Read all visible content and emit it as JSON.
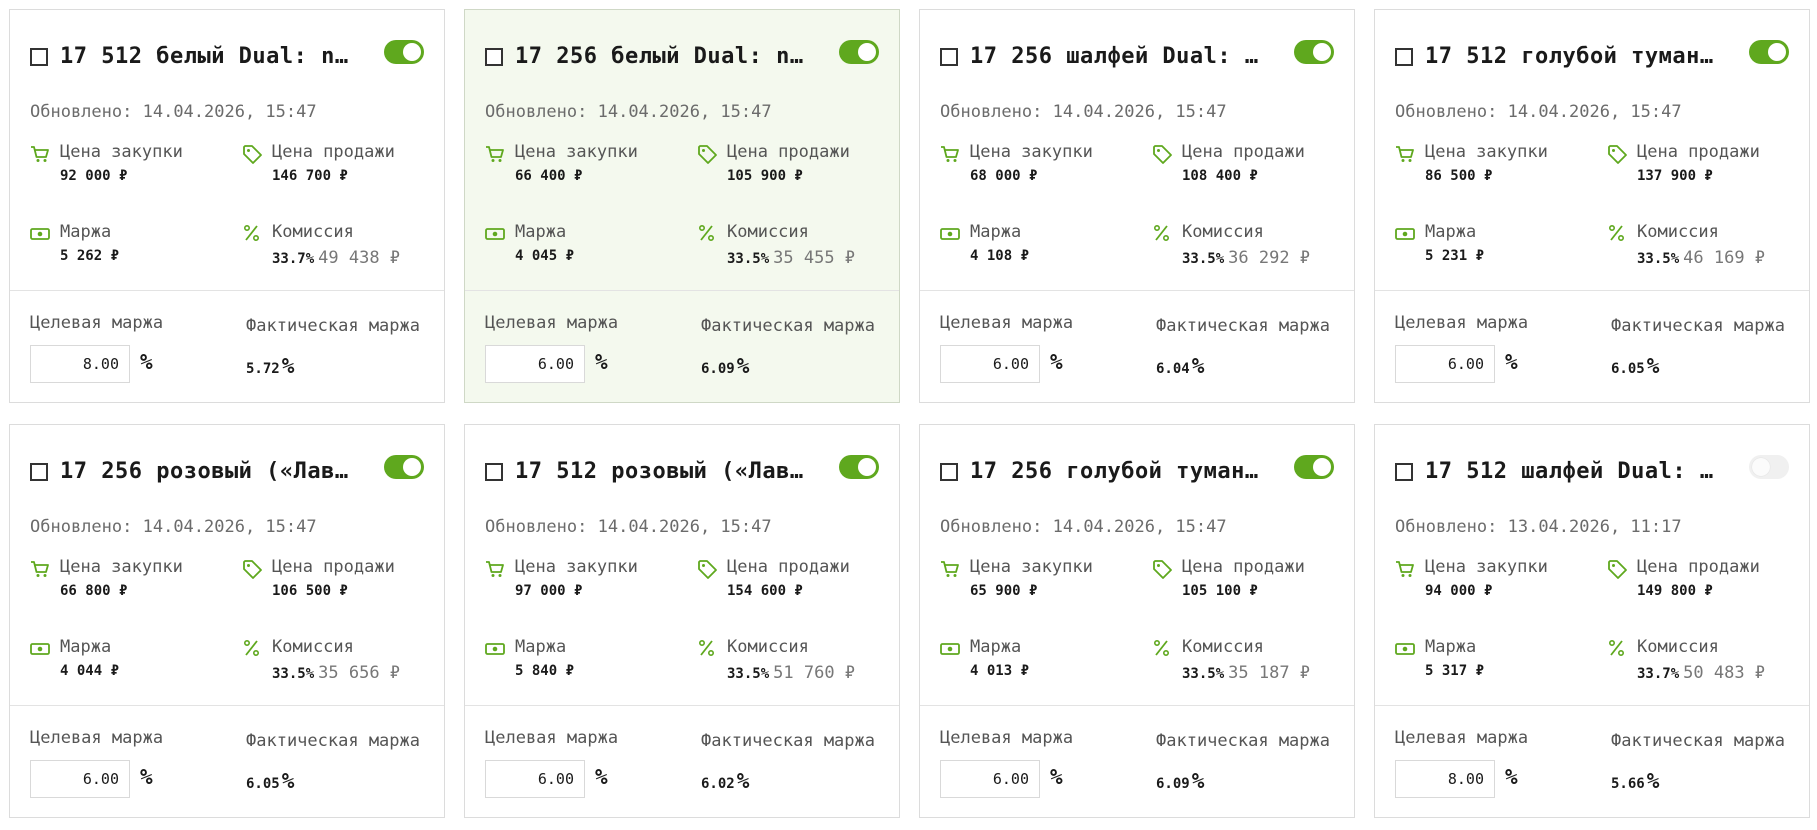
{
  "labels": {
    "updated_prefix": "Обновлено:",
    "buy_price": "Цена закупки",
    "sell_price": "Цена продажи",
    "margin": "Маржа",
    "commission": "Комиссия",
    "target_margin": "Целевая маржа",
    "actual_margin": "Фактическая маржа",
    "percent": "%"
  },
  "colors": {
    "accent": "#5fa81e",
    "selected_bg": "#f4f9ee"
  },
  "cards": [
    {
      "title": "17 512 белый Dual: na…",
      "enabled": true,
      "selected": false,
      "updated": "14.04.2026, 15:47",
      "buy": "92 000 ₽",
      "sell": "146 700 ₽",
      "margin": "5 262 ₽",
      "commission_pct": "33.7%",
      "commission_rub": "49 438 ₽",
      "target": "8.00",
      "actual": "5.72"
    },
    {
      "title": "17 256 белый Dual: na…",
      "enabled": true,
      "selected": true,
      "updated": "14.04.2026, 15:47",
      "buy": "66 400 ₽",
      "sell": "105 900 ₽",
      "margin": "4 045 ₽",
      "commission_pct": "33.5%",
      "commission_rub": "35 455 ₽",
      "target": "6.00",
      "actual": "6.09"
    },
    {
      "title": "17 256 шалфей Dual: n…",
      "enabled": true,
      "selected": false,
      "updated": "14.04.2026, 15:47",
      "buy": "68 000 ₽",
      "sell": "108 400 ₽",
      "margin": "4 108 ₽",
      "commission_pct": "33.5%",
      "commission_rub": "36 292 ₽",
      "target": "6.00",
      "actual": "6.04"
    },
    {
      "title": "17 512 голубой туман …",
      "enabled": true,
      "selected": false,
      "updated": "14.04.2026, 15:47",
      "buy": "86 500 ₽",
      "sell": "137 900 ₽",
      "margin": "5 231 ₽",
      "commission_pct": "33.5%",
      "commission_rub": "46 169 ₽",
      "target": "6.00",
      "actual": "6.05"
    },
    {
      "title": "17 256 розовый («Лава…",
      "enabled": true,
      "selected": false,
      "updated": "14.04.2026, 15:47",
      "buy": "66 800 ₽",
      "sell": "106 500 ₽",
      "margin": "4 044 ₽",
      "commission_pct": "33.5%",
      "commission_rub": "35 656 ₽",
      "target": "6.00",
      "actual": "6.05"
    },
    {
      "title": "17 512 розовый («Лава…",
      "enabled": true,
      "selected": false,
      "updated": "14.04.2026, 15:47",
      "buy": "97 000 ₽",
      "sell": "154 600 ₽",
      "margin": "5 840 ₽",
      "commission_pct": "33.5%",
      "commission_rub": "51 760 ₽",
      "target": "6.00",
      "actual": "6.02"
    },
    {
      "title": "17 256 голубой туман …",
      "enabled": true,
      "selected": false,
      "updated": "14.04.2026, 15:47",
      "buy": "65 900 ₽",
      "sell": "105 100 ₽",
      "margin": "4 013 ₽",
      "commission_pct": "33.5%",
      "commission_rub": "35 187 ₽",
      "target": "6.00",
      "actual": "6.09"
    },
    {
      "title": "17 512 шалфей Dual: n…",
      "enabled": false,
      "selected": false,
      "updated": "13.04.2026, 11:17",
      "buy": "94 000 ₽",
      "sell": "149 800 ₽",
      "margin": "5 317 ₽",
      "commission_pct": "33.7%",
      "commission_rub": "50 483 ₽",
      "target": "8.00",
      "actual": "5.66"
    }
  ]
}
